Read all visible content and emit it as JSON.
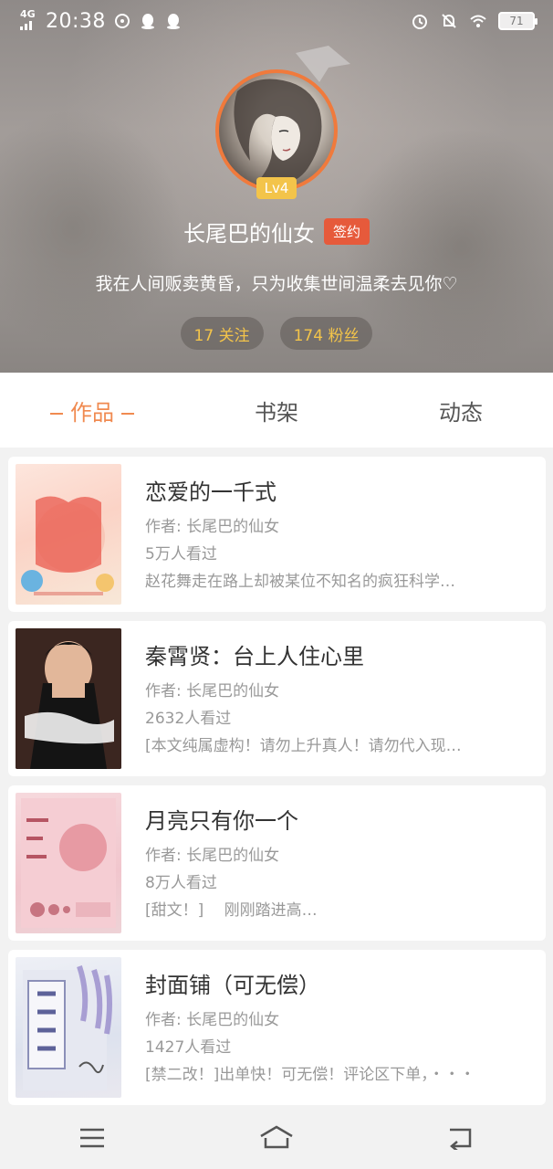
{
  "status_bar": {
    "network": "4G",
    "time": "20:38",
    "battery": "71"
  },
  "profile": {
    "level": "Lv4",
    "username": "长尾巴的仙女",
    "badge": "签约",
    "bio": "我在人间贩卖黄昏，只为收集世间温柔去见你♡",
    "following": "17 关注",
    "followers": "174 粉丝",
    "accent_color": "#f07a3c"
  },
  "tabs": [
    {
      "label": "作品",
      "active": true
    },
    {
      "label": "书架",
      "active": false
    },
    {
      "label": "动态",
      "active": false
    }
  ],
  "books": [
    {
      "title": "恋爱的一千式",
      "author": "作者: 长尾巴的仙女",
      "views": "5万人看过",
      "desc": "赵花舞走在路上却被某位不知名的疯狂科学…"
    },
    {
      "title": "秦霄贤：台上人住心里",
      "author": "作者: 长尾巴的仙女",
      "views": "2632人看过",
      "desc": "[本文纯属虚构！请勿上升真人！请勿代入现…"
    },
    {
      "title": "月亮只有你一个",
      "author": "作者: 长尾巴的仙女",
      "views": "8万人看过",
      "desc": "[甜文！]　 刚刚踏进高…"
    },
    {
      "title": "封面铺（可无偿）",
      "author": "作者: 长尾巴的仙女",
      "views": "1427人看过",
      "desc": "[禁二改！]出单快！可无偿！评论区下单，・・・"
    }
  ],
  "bottom_nav": [
    "menu-icon",
    "home-icon",
    "back-icon"
  ]
}
